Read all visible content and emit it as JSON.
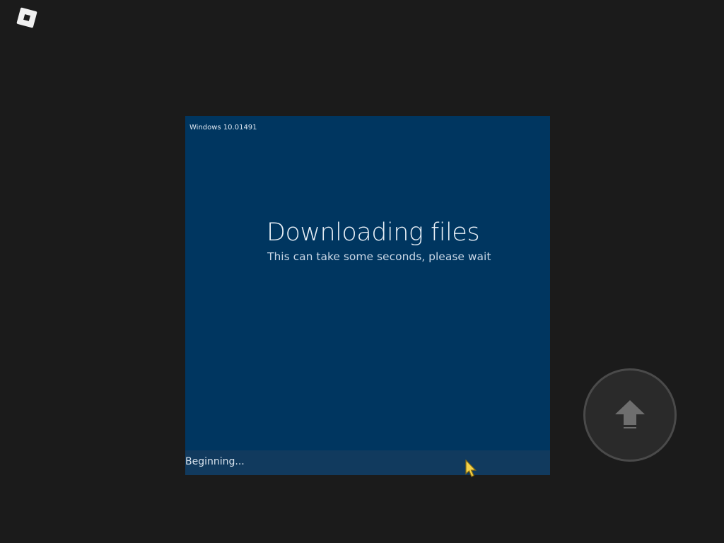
{
  "hud": {
    "menu_icon": "roblox-logo-icon",
    "jump_icon": "up-arrow-icon"
  },
  "screen": {
    "version": "Windows 10.01491",
    "title": "Downloading files",
    "subtitle": "This can take some seconds, please wait",
    "status": "Beginning..."
  },
  "colors": {
    "background": "#1b1b1b",
    "screen": "#003660",
    "status_bar": "#113a5e",
    "cursor": "#f3d24a"
  }
}
